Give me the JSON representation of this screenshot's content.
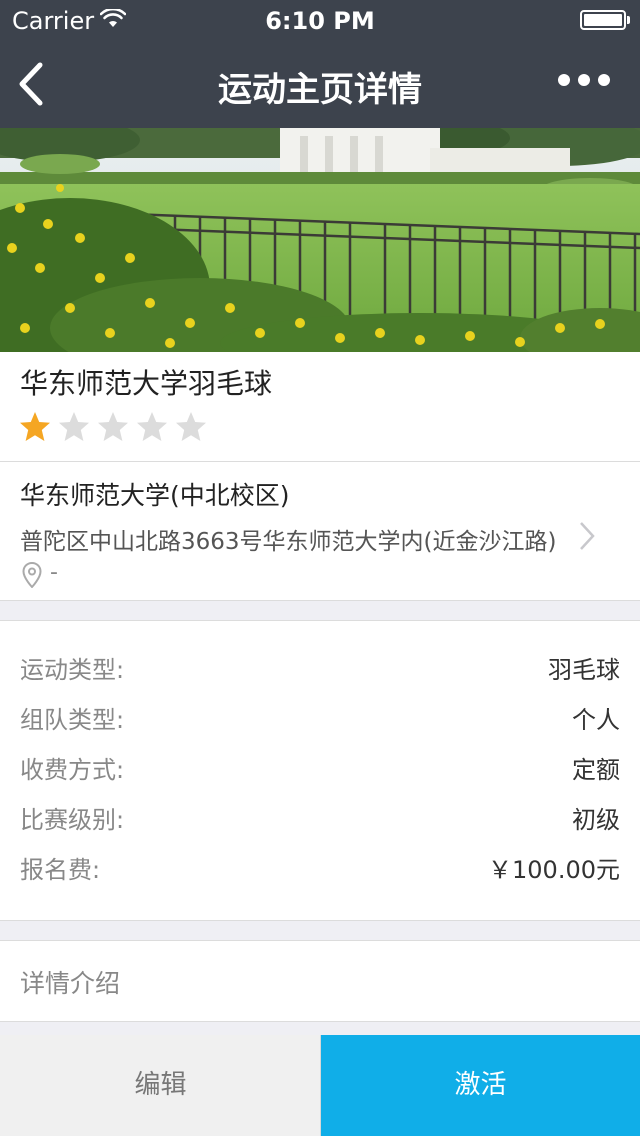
{
  "status_bar": {
    "carrier": "Carrier",
    "time": "6:10 PM"
  },
  "nav": {
    "title": "运动主页详情",
    "back_icon": "chevron-left-icon",
    "more_icon": "more-dots-icon"
  },
  "venue": {
    "name": "华东师范大学羽毛球",
    "rating": 1,
    "rating_max": 5,
    "campus": "华东师范大学(中北校区)",
    "address": "普陀区中山北路3663号华东师范大学内(近金沙江路)",
    "distance": "-"
  },
  "info": [
    {
      "label": "运动类型:",
      "value": "羽毛球"
    },
    {
      "label": "组队类型:",
      "value": "个人"
    },
    {
      "label": "收费方式:",
      "value": "定额"
    },
    {
      "label": "比赛级别:",
      "value": "初级"
    },
    {
      "label": "报名费:",
      "value": "￥100.00元"
    }
  ],
  "details": {
    "label": "详情介绍"
  },
  "actions": {
    "edit_label": "编辑",
    "activate_label": "激活"
  },
  "colors": {
    "nav_bg": "#3d434d",
    "accent": "#10aee8",
    "star_active": "#f5a623",
    "star_inactive": "#dcdcdc"
  }
}
